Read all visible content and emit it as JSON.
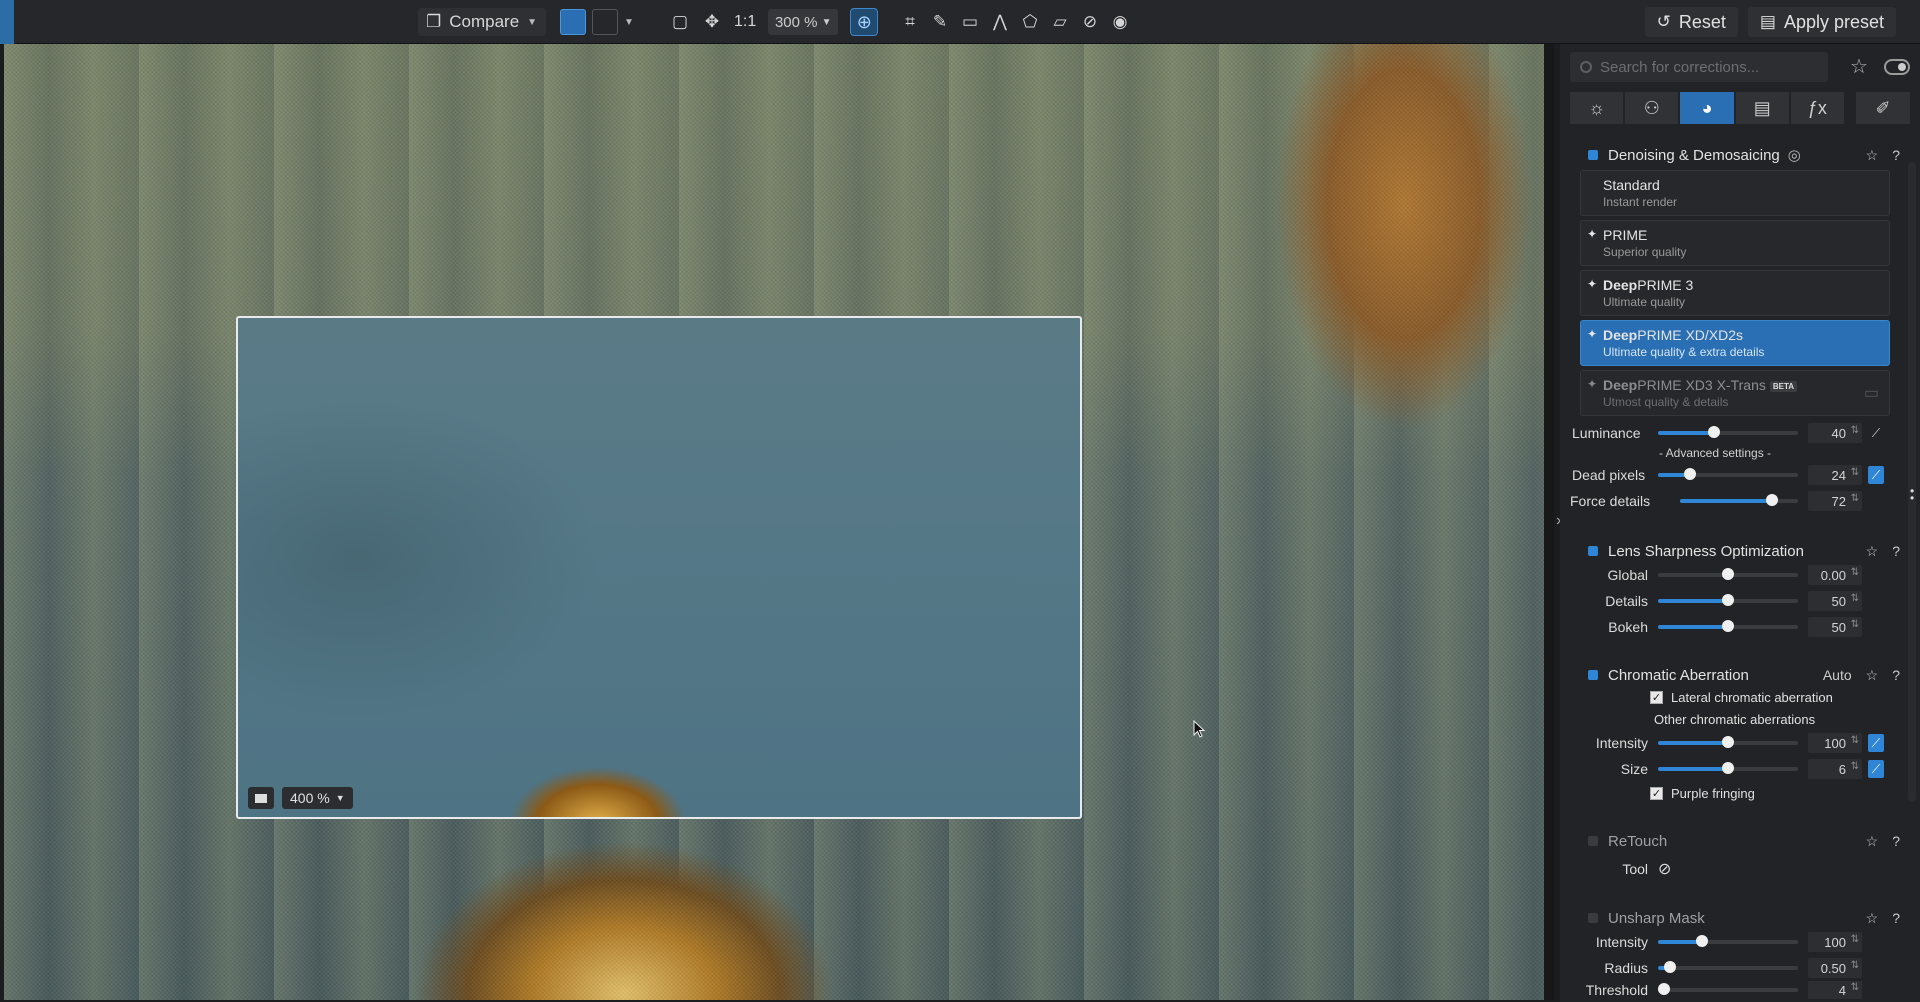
{
  "toolbar": {
    "compare_label": "Compare",
    "one_to_one": "1:1",
    "zoom_value": "300 %",
    "reset_label": "Reset",
    "apply_preset_label": "Apply preset"
  },
  "loupe": {
    "zoom": "400 %"
  },
  "panel": {
    "search_placeholder": "Search for corrections...",
    "denoise": {
      "title": "Denoising & Demosaicing",
      "modes": [
        {
          "name": "Standard",
          "bold": "",
          "sub": "Instant render"
        },
        {
          "name": "PRIME",
          "bold": "",
          "sub": "Superior quality"
        },
        {
          "name": "PRIME 3",
          "bold": "Deep",
          "sub": "Ultimate quality"
        },
        {
          "name": "PRIME XD/XD2s",
          "bold": "Deep",
          "sub": "Ultimate quality & extra details"
        },
        {
          "name": "PRIME XD3 X-Trans",
          "bold": "Deep",
          "sub": "Utmost quality & details",
          "badge": "BETA"
        }
      ],
      "luminance_label": "Luminance",
      "luminance_value": "40",
      "advanced_settings": "- Advanced settings -",
      "dead_pixels_label": "Dead pixels",
      "dead_pixels_value": "24",
      "force_details_label": "Force details",
      "force_details_value": "72"
    },
    "lens": {
      "title": "Lens Sharpness Optimization",
      "global_label": "Global",
      "global_value": "0.00",
      "details_label": "Details",
      "details_value": "50",
      "bokeh_label": "Bokeh",
      "bokeh_value": "50"
    },
    "chromatic": {
      "title": "Chromatic Aberration",
      "auto_label": "Auto",
      "lateral_label": "Lateral chromatic aberration",
      "other_label": "Other chromatic aberrations",
      "intensity_label": "Intensity",
      "intensity_value": "100",
      "size_label": "Size",
      "size_value": "6",
      "purple_label": "Purple fringing"
    },
    "retouch": {
      "title": "ReTouch",
      "tool_label": "Tool"
    },
    "unsharp": {
      "title": "Unsharp Mask",
      "intensity_label": "Intensity",
      "intensity_value": "100",
      "radius_label": "Radius",
      "radius_value": "0.50",
      "threshold_label": "Threshold",
      "threshold_value": "4"
    }
  },
  "colors": {
    "accent": "#2a6fb3",
    "panel_bg": "#222326"
  }
}
